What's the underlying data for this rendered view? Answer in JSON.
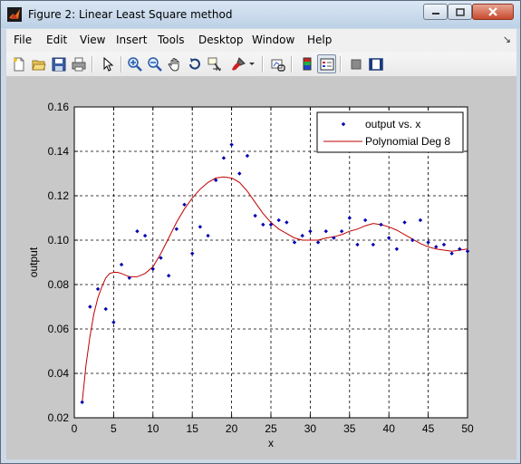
{
  "window": {
    "title": "Figure 2: Linear Least Square method"
  },
  "menu": {
    "items": [
      "File",
      "Edit",
      "View",
      "Insert",
      "Tools",
      "Desktop",
      "Window",
      "Help"
    ]
  },
  "toolbar": {
    "icons": [
      "new-file-icon",
      "open-folder-icon",
      "save-icon",
      "print-icon",
      "pointer-icon",
      "zoom-in-icon",
      "zoom-out-icon",
      "pan-hand-icon",
      "rotate-3d-icon",
      "data-cursor-icon",
      "brush-icon",
      "link-plot-icon",
      "colorbar-icon",
      "legend-icon",
      "hide-plot-tools-icon",
      "show-plot-tools-icon"
    ]
  },
  "colors": {
    "points": "#0000b0",
    "curve": "#c00000"
  },
  "chart_data": {
    "type": "scatter",
    "xlabel": "x",
    "ylabel": "output",
    "xlim": [
      0,
      50
    ],
    "ylim": [
      0.02,
      0.16
    ],
    "xticks": [
      0,
      5,
      10,
      15,
      20,
      25,
      30,
      35,
      40,
      45,
      50
    ],
    "yticks": [
      0.02,
      0.04,
      0.06,
      0.08,
      0.1,
      0.12,
      0.14,
      0.16
    ],
    "grid": true,
    "legend_position": "top-right",
    "series": [
      {
        "name": "output vs. x",
        "kind": "points",
        "x": [
          1,
          2,
          3,
          4,
          5,
          6,
          7,
          8,
          9,
          10,
          11,
          12,
          13,
          14,
          15,
          16,
          17,
          18,
          19,
          20,
          21,
          22,
          23,
          24,
          25,
          26,
          27,
          28,
          29,
          30,
          31,
          32,
          33,
          34,
          35,
          36,
          37,
          38,
          39,
          40,
          41,
          42,
          43,
          44,
          45,
          46,
          47,
          48,
          49,
          50
        ],
        "y": [
          0.027,
          0.07,
          0.078,
          0.069,
          0.063,
          0.089,
          0.083,
          0.104,
          0.102,
          0.087,
          0.092,
          0.084,
          0.105,
          0.116,
          0.094,
          0.106,
          0.102,
          0.127,
          0.137,
          0.143,
          0.13,
          0.138,
          0.111,
          0.107,
          0.107,
          0.109,
          0.108,
          0.099,
          0.102,
          0.104,
          0.099,
          0.104,
          0.101,
          0.104,
          0.11,
          0.098,
          0.109,
          0.098,
          0.107,
          0.101,
          0.096,
          0.108,
          0.1,
          0.109,
          0.099,
          0.097,
          0.098,
          0.094,
          0.096,
          0.095
        ]
      },
      {
        "name": "Polynomial Deg 8",
        "kind": "line",
        "x": [
          1,
          1.5,
          2,
          2.5,
          3,
          3.5,
          4,
          4.5,
          5,
          5.5,
          6,
          7,
          8,
          9,
          10,
          11,
          12,
          13,
          14,
          15,
          16,
          17,
          18,
          19,
          20,
          21,
          22,
          23,
          24,
          25,
          26,
          27,
          28,
          29,
          30,
          31,
          32,
          33,
          34,
          35,
          36,
          37,
          38,
          39,
          40,
          41,
          42,
          43,
          44,
          45,
          46,
          47,
          48,
          49,
          50
        ],
        "y": [
          0.027,
          0.044,
          0.057,
          0.067,
          0.074,
          0.079,
          0.083,
          0.085,
          0.0855,
          0.0855,
          0.085,
          0.0835,
          0.0835,
          0.085,
          0.088,
          0.094,
          0.101,
          0.108,
          0.114,
          0.119,
          0.123,
          0.126,
          0.128,
          0.1285,
          0.128,
          0.126,
          0.122,
          0.117,
          0.112,
          0.108,
          0.105,
          0.103,
          0.101,
          0.1,
          0.1,
          0.1,
          0.101,
          0.1015,
          0.1025,
          0.104,
          0.105,
          0.1065,
          0.1075,
          0.107,
          0.106,
          0.1045,
          0.1025,
          0.1005,
          0.0985,
          0.097,
          0.096,
          0.0955,
          0.095,
          0.0955,
          0.096
        ]
      }
    ]
  }
}
